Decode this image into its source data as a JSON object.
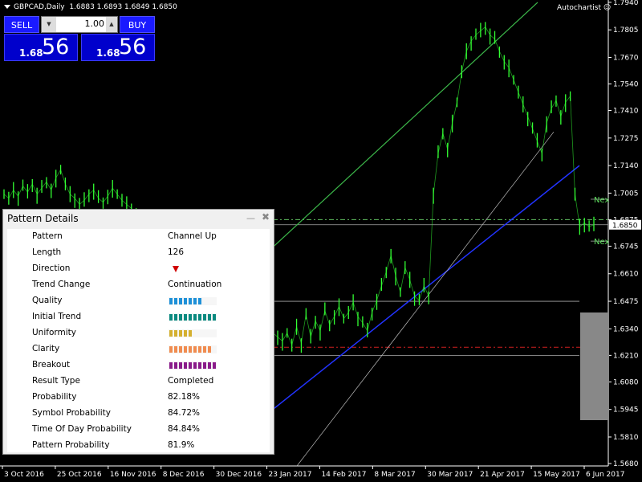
{
  "window": {
    "symbol": "GBPCAD,Daily",
    "ohlc": "1.6883 1.6893 1.6849 1.6850",
    "autochartist": "Autochartist",
    "autochartist_icon": "smiley-icon"
  },
  "trade_panel": {
    "sell_label": "SELL",
    "buy_label": "BUY",
    "lot": "1.00",
    "sell_price_small": "1.68",
    "sell_price_big": "56",
    "buy_price_small": "1.68",
    "buy_price_big": "56"
  },
  "pattern_panel": {
    "title": "Pattern Details",
    "rows": [
      {
        "key": "Pattern",
        "value": "Channel Up"
      },
      {
        "key": "Length",
        "value": "126"
      },
      {
        "key": "Direction",
        "value": ""
      },
      {
        "key": "Trend Change",
        "value": "Continuation"
      },
      {
        "key": "Quality",
        "value": ""
      },
      {
        "key": "Initial Trend",
        "value": ""
      },
      {
        "key": "Uniformity",
        "value": ""
      },
      {
        "key": "Clarity",
        "value": ""
      },
      {
        "key": "Breakout",
        "value": ""
      },
      {
        "key": "Result Type",
        "value": "Completed"
      },
      {
        "key": "Probability",
        "value": "82.18%"
      },
      {
        "key": "Symbol Probability",
        "value": "84.72%"
      },
      {
        "key": "Time Of Day Probability",
        "value": "84.84%"
      },
      {
        "key": "Pattern Probability",
        "value": "81.9%"
      }
    ],
    "direction": "down",
    "ratings": [
      {
        "name": "Quality",
        "value": 0.7,
        "color": "#1e90d8"
      },
      {
        "name": "Initial Trend",
        "value": 1.0,
        "color": "#0a8a80"
      },
      {
        "name": "Uniformity",
        "value": 0.5,
        "color": "#d4b030"
      },
      {
        "name": "Clarity",
        "value": 0.9,
        "color": "#f08c50"
      },
      {
        "name": "Breakout",
        "value": 1.0,
        "color": "#8a1a8a"
      }
    ]
  },
  "chart_data": {
    "type": "line",
    "y_ticks": [
      "1.7940",
      "1.7805",
      "1.7670",
      "1.7540",
      "1.7410",
      "1.7275",
      "1.7140",
      "1.7005",
      "1.6875",
      "1.6745",
      "1.6610",
      "1.6475",
      "1.6340",
      "1.6210",
      "1.6080",
      "1.5945",
      "1.5810",
      "1.5680"
    ],
    "current_price": "1.6850",
    "x_ticks": [
      "3 Oct 2016",
      "25 Oct 2016",
      "16 Nov 2016",
      "8 Dec 2016",
      "30 Dec 2016",
      "23 Jan 2017",
      "14 Feb 2017",
      "8 Mar 2017",
      "30 Mar 2017",
      "21 Apr 2017",
      "15 May 2017",
      "6 Jun 2017"
    ],
    "ylim": [
      1.568,
      1.794
    ],
    "series": [
      {
        "values": [
          1.7,
          1.698,
          1.702,
          1.699,
          1.704,
          1.701,
          1.705,
          1.7,
          1.703,
          1.706,
          1.702,
          1.708,
          1.712,
          1.705,
          1.7,
          1.698,
          1.695,
          1.697,
          1.7,
          1.702,
          1.698,
          1.696,
          1.699,
          1.703,
          1.7,
          1.697,
          1.695,
          1.693,
          1.69,
          1.688,
          1.686,
          1.684,
          1.682,
          1.68,
          1.678,
          1.676,
          1.674,
          1.672,
          1.67,
          1.668,
          1.666,
          1.664,
          1.662,
          1.66,
          1.658,
          1.656,
          1.654,
          1.652,
          1.65,
          1.648,
          1.646,
          1.644,
          1.642,
          1.64,
          1.638,
          1.636,
          1.634,
          1.632,
          1.63,
          1.628,
          1.632,
          1.626,
          1.635,
          1.627,
          1.641,
          1.63,
          1.638,
          1.633,
          1.643,
          1.636,
          1.64,
          1.645,
          1.639,
          1.642,
          1.647,
          1.64,
          1.637,
          1.633,
          1.642,
          1.648,
          1.655,
          1.662,
          1.67,
          1.66,
          1.652,
          1.664,
          1.658,
          1.65,
          1.648,
          1.655,
          1.65,
          1.7,
          1.72,
          1.73,
          1.722,
          1.735,
          1.745,
          1.76,
          1.77,
          1.775,
          1.778,
          1.78,
          1.782,
          1.778,
          1.776,
          1.77,
          1.765,
          1.762,
          1.756,
          1.75,
          1.744,
          1.738,
          1.732,
          1.726,
          1.72,
          1.735,
          1.742,
          1.746,
          1.738,
          1.745,
          1.748,
          1.7,
          1.684,
          1.686,
          1.684,
          1.685
        ]
      }
    ],
    "annotations": [
      {
        "text": "Nex",
        "price": 1.6975
      },
      {
        "text": "Nex",
        "price": 1.677
      }
    ]
  }
}
